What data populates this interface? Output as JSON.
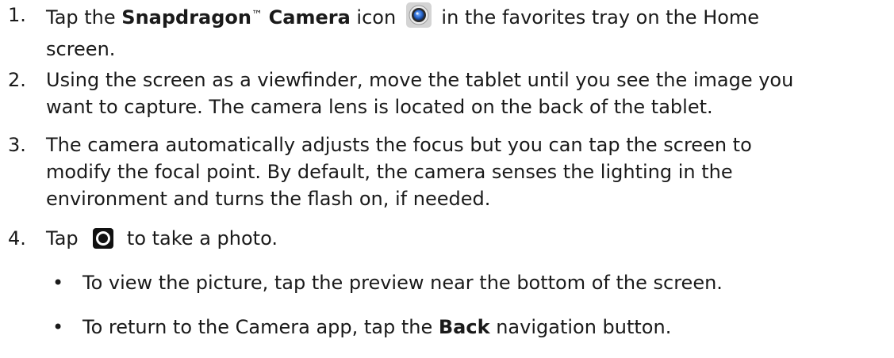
{
  "steps": [
    {
      "number": "1.",
      "pre": "Tap the ",
      "bold1": "Snapdragon",
      "tm": "™",
      "bold2": "Camera",
      "mid": " icon",
      "icon": "camera-app-icon",
      "post": " in the favorites tray on the Home",
      "line2": "screen."
    },
    {
      "number": "2.",
      "line1": "Using the screen as a viewfinder, move the tablet until you see the image you",
      "line2": "want to capture. The camera lens is located on the back of the tablet."
    },
    {
      "number": "3.",
      "line1": "The camera automatically adjusts the focus but you can tap the screen to",
      "line2": "modify the focal point. By default, the camera senses the lighting in the",
      "line3": "environment and turns the flash on, if needed."
    },
    {
      "number": "4.",
      "pre": "Tap",
      "icon": "shutter-button-icon",
      "post": " to take a photo.",
      "bullets": [
        {
          "dot": "•",
          "text": "To view the picture, tap the preview near the bottom of the screen."
        },
        {
          "dot": "•",
          "pre": "To return to the Camera app, tap the ",
          "bold": "Back",
          "post": " navigation button."
        }
      ]
    }
  ],
  "colors": {
    "text": "#1a1a1a",
    "icon_dark": "#111111",
    "camera_icon_blue": "#2f6fd6"
  }
}
